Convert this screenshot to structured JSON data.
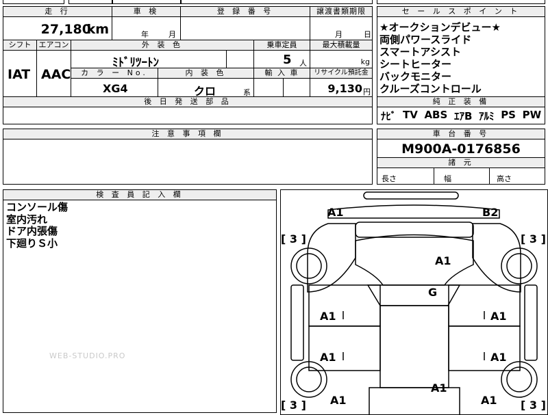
{
  "top_partial": {
    "t1": "",
    "t2": "",
    "t3": "",
    "t4": ""
  },
  "mileage": {
    "header": "走 行",
    "value": "27,180",
    "unit": "km"
  },
  "inspection": {
    "header": "車 検",
    "year_label": "年",
    "month_label": "月"
  },
  "registration": {
    "header": "登 録 番 号"
  },
  "transfer_deadline": {
    "header": "譲渡書類期限",
    "month_label": "月",
    "day_label": "日"
  },
  "shift": {
    "header": "シフト",
    "value": "IAT"
  },
  "aircon": {
    "header": "エアコン",
    "value": "AAC"
  },
  "exterior_color": {
    "header": "外 装 色",
    "value": "ﾐﾄﾞﾘﾂｰﾄﾝ"
  },
  "color_no": {
    "header": "カ ラ ー No.",
    "value": "XG4"
  },
  "interior_color": {
    "header": "内 装 色",
    "value": "クロ",
    "suffix": "系"
  },
  "capacity": {
    "header": "乗車定員",
    "value": "5",
    "unit": "人"
  },
  "max_load": {
    "header": "最大積載量",
    "unit": "kg"
  },
  "import_car": {
    "header": "輸 入 車"
  },
  "recycle_fee": {
    "header": "リサイクル預託金",
    "value": "9,130",
    "unit": "円"
  },
  "later_parts": {
    "header": "後 日 発 送 部 品"
  },
  "sales_points": {
    "header": "セ ー ル ス ポ イ ン ト",
    "items": [
      "★オークションデビュー★",
      "両側パワースライド",
      "スマートアシスト",
      "シートヒーター",
      "バックモニター",
      "クルーズコントロール"
    ]
  },
  "standard_equipment": {
    "header": "純 正 装 備",
    "items": [
      "ﾅﾋﾞ",
      "TV",
      "ABS",
      "ｴｱB",
      "ｱﾙﾐ",
      "PS",
      "PW"
    ]
  },
  "notes_section": {
    "header": "注 意 事 項 欄"
  },
  "chassis": {
    "header": "車 台 番 号",
    "value": "M900A-0176856"
  },
  "dimensions": {
    "header": "諸 元",
    "length": "長さ",
    "width": "幅",
    "height": "高さ"
  },
  "inspector_notes": {
    "header": "検 査 員 記 入 欄",
    "lines": [
      "コンソール傷",
      "室内汚れ",
      "ドア内張傷",
      "下廻りＳ小"
    ]
  },
  "diagram": {
    "top_left": "A1",
    "top_right": "B2",
    "bracket_l": "[ 3 ]",
    "bracket_r": "[ 3 ]",
    "hood": "A1",
    "windshield": "G",
    "left_front_door": "A1",
    "right_front_door": "A1",
    "left_rear_door": "A1",
    "right_rear_door": "A1",
    "roof": "A1",
    "rear_left": "A1",
    "rear_right": "A1",
    "bracket_bl": "[ 3 ]",
    "bracket_br": "[ 3 ]"
  },
  "watermark": "WEB-STUDIO.PRO"
}
